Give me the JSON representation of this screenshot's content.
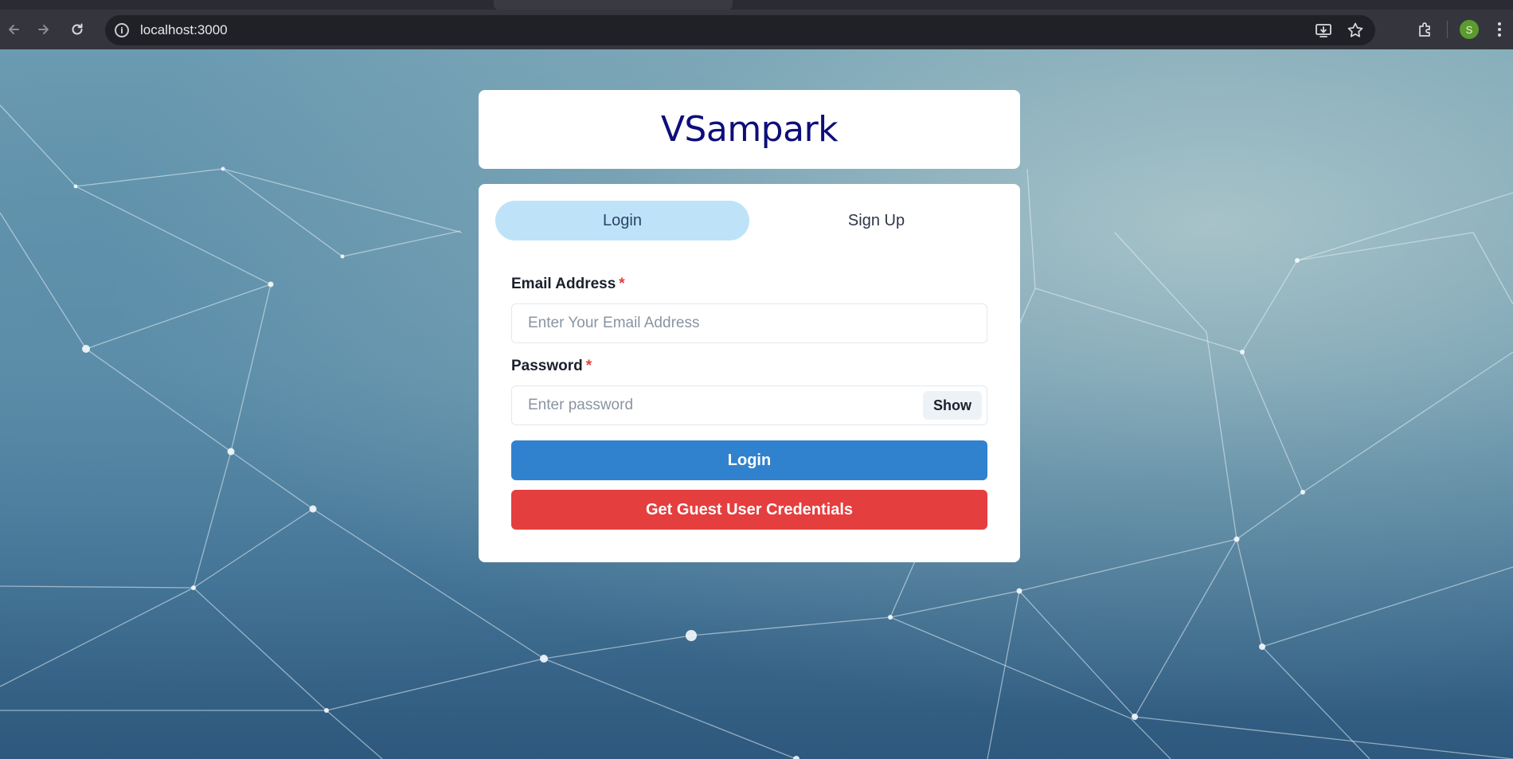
{
  "browser": {
    "url": "localhost:3000",
    "profile_initial": "S",
    "profile_color": "#5c9b2e"
  },
  "app": {
    "brand": "VSampark"
  },
  "auth": {
    "tabs": [
      {
        "label": "Login",
        "selected": true
      },
      {
        "label": "Sign Up",
        "selected": false
      }
    ],
    "email": {
      "label": "Email Address",
      "required_mark": "*",
      "placeholder": "Enter Your Email Address",
      "value": ""
    },
    "password": {
      "label": "Password",
      "required_mark": "*",
      "placeholder": "Enter password",
      "value": "",
      "toggle_label": "Show"
    },
    "login_button": "Login",
    "guest_button": "Get Guest User Credentials"
  },
  "colors": {
    "brand_text": "#0e0e7a",
    "tab_selected": "#bee3f8",
    "primary_button": "#3182ce",
    "danger_button": "#e53e3e",
    "required_mark": "#e53e3e"
  }
}
